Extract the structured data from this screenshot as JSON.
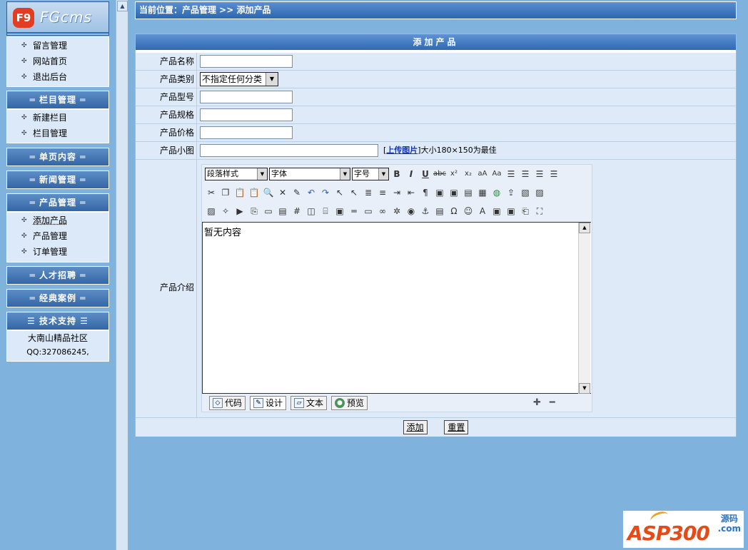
{
  "logo": {
    "mark": "F9",
    "text": "FGcms"
  },
  "top_links": [
    "留言管理",
    "网站首页",
    "退出后台"
  ],
  "sections": [
    {
      "title": "栏目管理",
      "items": [
        "新建栏目",
        "栏目管理"
      ]
    },
    {
      "title": "单页内容",
      "items": []
    },
    {
      "title": "新闻管理",
      "items": []
    },
    {
      "title": "产品管理",
      "items": [
        "添加产品",
        "产品管理",
        "订单管理"
      ]
    },
    {
      "title": "人才招聘",
      "items": []
    },
    {
      "title": "经典案例",
      "items": []
    }
  ],
  "support": {
    "title": "技术支持",
    "line1": "大南山精品社区",
    "line2": "QQ:327086245,"
  },
  "crumb": "当前位置：产品管理  >> 添加产品",
  "form": {
    "title": "添加产品",
    "name_label": "产品名称",
    "category_label": "产品类别",
    "category_value": "不指定任何分类",
    "model_label": "产品型号",
    "spec_label": "产品规格",
    "price_label": "产品价格",
    "image_label": "产品小图",
    "upload_link": "上传图片",
    "upload_hint": "大小180×150为最佳",
    "intro_label": "产品介绍",
    "submit": "添加",
    "reset": "重置"
  },
  "editor": {
    "paragraph_style": "段落样式",
    "font": "字体",
    "size": "字号",
    "content": "暂无内容",
    "modes": [
      "代码",
      "设计",
      "文本",
      "预览"
    ],
    "active_mode": "设计"
  },
  "watermark": {
    "big": "ASP300",
    "small1": "源码",
    "small2": ".com"
  }
}
